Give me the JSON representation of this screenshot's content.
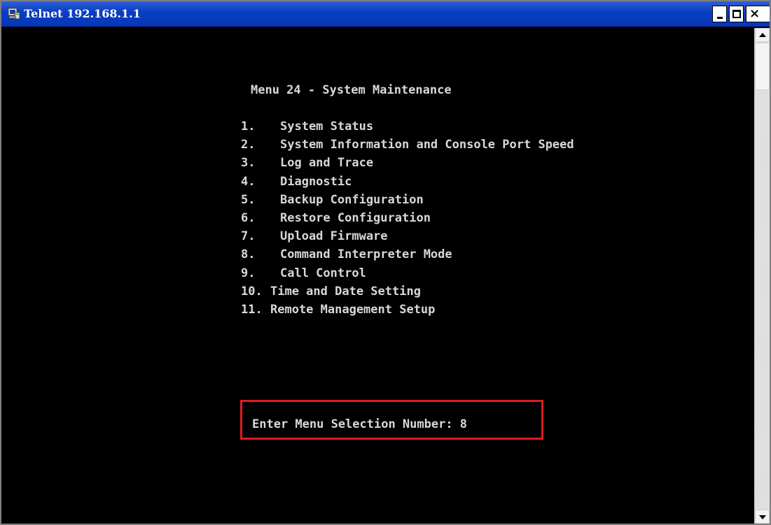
{
  "window": {
    "title": "Telnet 192.168.1.1",
    "close_glyph": "×"
  },
  "terminal": {
    "menu_title": "Menu 24 - System Maintenance",
    "items": [
      {
        "num": "1.",
        "label": "System Status"
      },
      {
        "num": "2.",
        "label": "System Information and Console Port Speed"
      },
      {
        "num": "3.",
        "label": "Log and Trace"
      },
      {
        "num": "4.",
        "label": "Diagnostic"
      },
      {
        "num": "5.",
        "label": "Backup Configuration"
      },
      {
        "num": "6.",
        "label": "Restore Configuration"
      },
      {
        "num": "7.",
        "label": "Upload Firmware"
      },
      {
        "num": "8.",
        "label": "Command Interpreter Mode"
      },
      {
        "num": "9.",
        "label": "Call Control"
      },
      {
        "num": "10.",
        "label": "Time and Date Setting"
      },
      {
        "num": "11.",
        "label": "Remote Management Setup"
      }
    ],
    "prompt": "Enter Menu Selection Number: 8"
  },
  "colors": {
    "titlebar": "#0a3fc3",
    "terminal_bg": "#000000",
    "terminal_text": "#d8d8d8",
    "highlight_box": "#e21a22"
  },
  "icons": {
    "app": "telnet-terminal-icon",
    "minimize": "minimize-icon",
    "maximize": "maximize-icon",
    "close": "close-icon",
    "scroll_up": "arrow-up-icon",
    "scroll_down": "arrow-down-icon"
  }
}
